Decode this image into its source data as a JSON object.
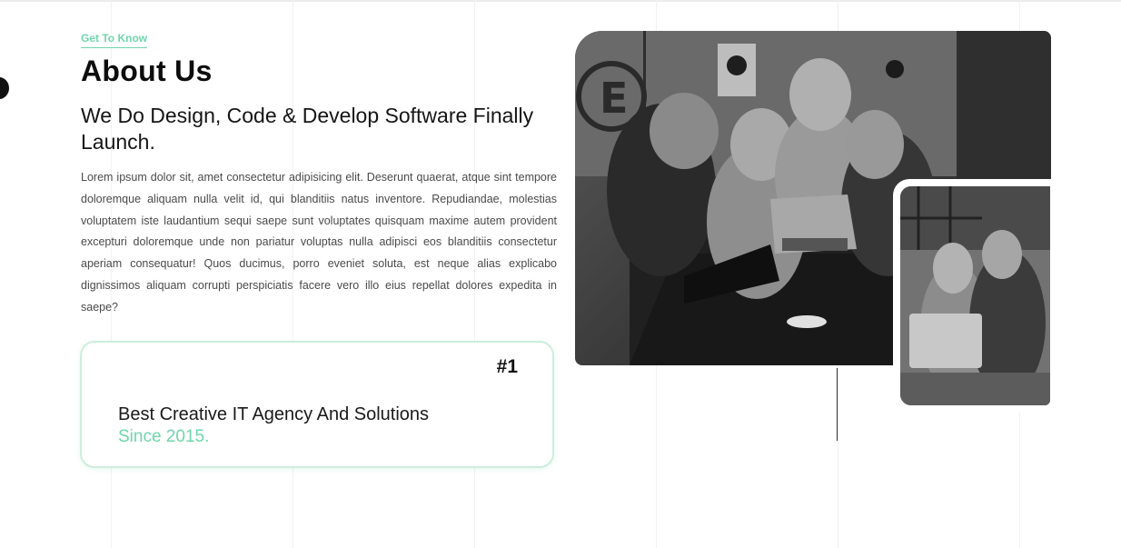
{
  "about": {
    "eyebrow": "Get To Know",
    "title": "About Us",
    "subtitle": "We Do Design, Code & Develop Software Finally Launch.",
    "body": "Lorem ipsum dolor sit, amet consectetur adipisicing elit. Deserunt quaerat, atque sint tempore doloremque aliquam nulla velit id, qui blanditiis natus inventore. Repudiandae, molestias voluptatem iste laudantium sequi saepe sunt voluptates quisquam maxime autem provident excepturi doloremque unde non pariatur voluptas nulla adipisci eos blanditiis consectetur aperiam consequatur! Quos ducimus, porro eveniet soluta, est neque alias explicabo dignissimos aliquam corrupti perspiciatis facere vero illo eius repellat dolores expedita in saepe?"
  },
  "highlight": {
    "badge": "#1",
    "line1": "Best Creative IT Agency And Solutions",
    "line2": "Since 2015."
  },
  "images": {
    "main": "team-at-laptop-photo",
    "secondary": "colleagues-at-laptop-photo"
  },
  "colors": {
    "accent": "#6fd6ac",
    "text": "#111111",
    "body_text": "#4a4a4a"
  }
}
